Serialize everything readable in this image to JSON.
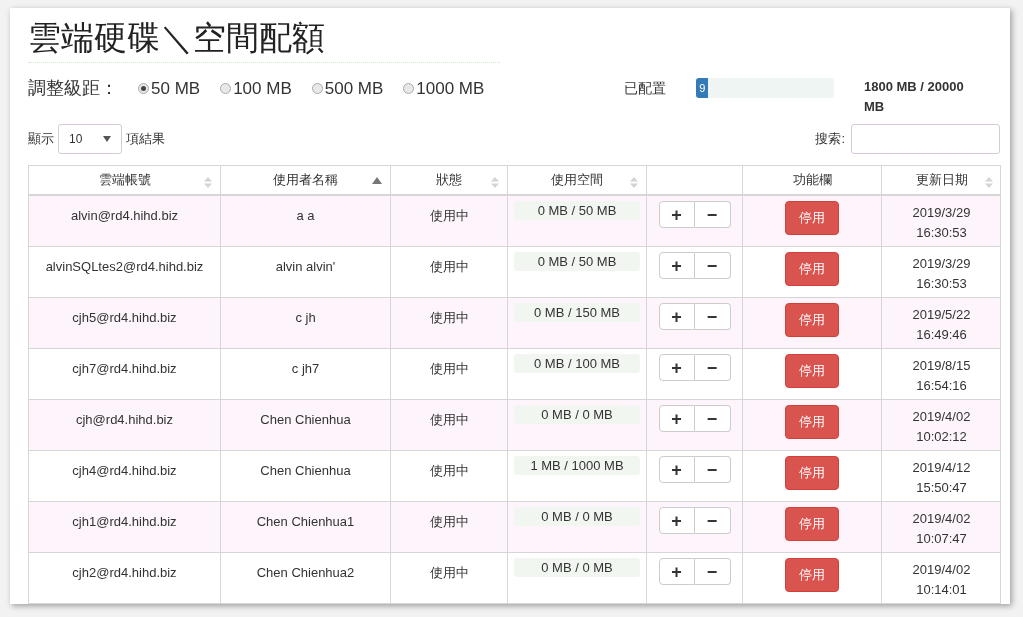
{
  "title": "雲端硬碟＼空間配額",
  "step": {
    "label": "調整級距：",
    "options": [
      {
        "label": "50 MB",
        "selected": true
      },
      {
        "label": "100 MB",
        "selected": false
      },
      {
        "label": "500 MB",
        "selected": false
      },
      {
        "label": "1000 MB",
        "selected": false
      }
    ]
  },
  "quota": {
    "label": "已配置",
    "badge": "9",
    "level": 0.09,
    "reading": "1800 MB / 20000 MB"
  },
  "length": {
    "prefix": "顯示",
    "value": "10",
    "suffix": "項結果"
  },
  "search": {
    "label": "搜索:"
  },
  "table": {
    "columns": [
      {
        "label": "雲端帳號",
        "sortable": true,
        "sorted": false
      },
      {
        "label": "使用者名稱",
        "sortable": true,
        "sorted": true
      },
      {
        "label": "狀態",
        "sortable": true,
        "sorted": false
      },
      {
        "label": "使用空間",
        "sortable": true,
        "sorted": false
      },
      {},
      {
        "label": "功能欄"
      },
      {
        "label": "更新日期",
        "sortable": true,
        "sorted": false
      }
    ],
    "rows": [
      {
        "account": "alvin@rd4.hihd.biz",
        "name": "a a",
        "status": "使用中",
        "usage": "0 MB / 50 MB",
        "plus": "+",
        "minus": "−",
        "action": "停用",
        "date": "2019/3/29",
        "time": "16:30:53"
      },
      {
        "account": "alvinSQLtes2@rd4.hihd.biz",
        "name": "alvin alvin'",
        "status": "使用中",
        "usage": "0 MB / 50 MB",
        "plus": "+",
        "minus": "−",
        "action": "停用",
        "date": "2019/3/29",
        "time": "16:30:53"
      },
      {
        "account": "cjh5@rd4.hihd.biz",
        "name": "c jh",
        "status": "使用中",
        "usage": "0 MB / 150 MB",
        "plus": "+",
        "minus": "−",
        "action": "停用",
        "date": "2019/5/22",
        "time": "16:49:46"
      },
      {
        "account": "cjh7@rd4.hihd.biz",
        "name": "c jh7",
        "status": "使用中",
        "usage": "0 MB / 100 MB",
        "plus": "+",
        "minus": "−",
        "action": "停用",
        "date": "2019/8/15",
        "time": "16:54:16"
      },
      {
        "account": "cjh@rd4.hihd.biz",
        "name": "Chen Chienhua",
        "status": "使用中",
        "usage": "0 MB / 0 MB",
        "plus": "+",
        "minus": "−",
        "action": "停用",
        "date": "2019/4/02",
        "time": "10:02:12"
      },
      {
        "account": "cjh4@rd4.hihd.biz",
        "name": "Chen Chienhua",
        "status": "使用中",
        "usage": "1 MB / 1000 MB",
        "plus": "+",
        "minus": "−",
        "action": "停用",
        "date": "2019/4/12",
        "time": "15:50:47"
      },
      {
        "account": "cjh1@rd4.hihd.biz",
        "name": "Chen Chienhua1",
        "status": "使用中",
        "usage": "0 MB / 0 MB",
        "plus": "+",
        "minus": "−",
        "action": "停用",
        "date": "2019/4/02",
        "time": "10:07:47"
      },
      {
        "account": "cjh2@rd4.hihd.biz",
        "name": "Chen Chienhua2",
        "status": "使用中",
        "usage": "0 MB / 0 MB",
        "plus": "+",
        "minus": "−",
        "action": "停用",
        "date": "2019/4/02",
        "time": "10:14:01"
      }
    ]
  }
}
